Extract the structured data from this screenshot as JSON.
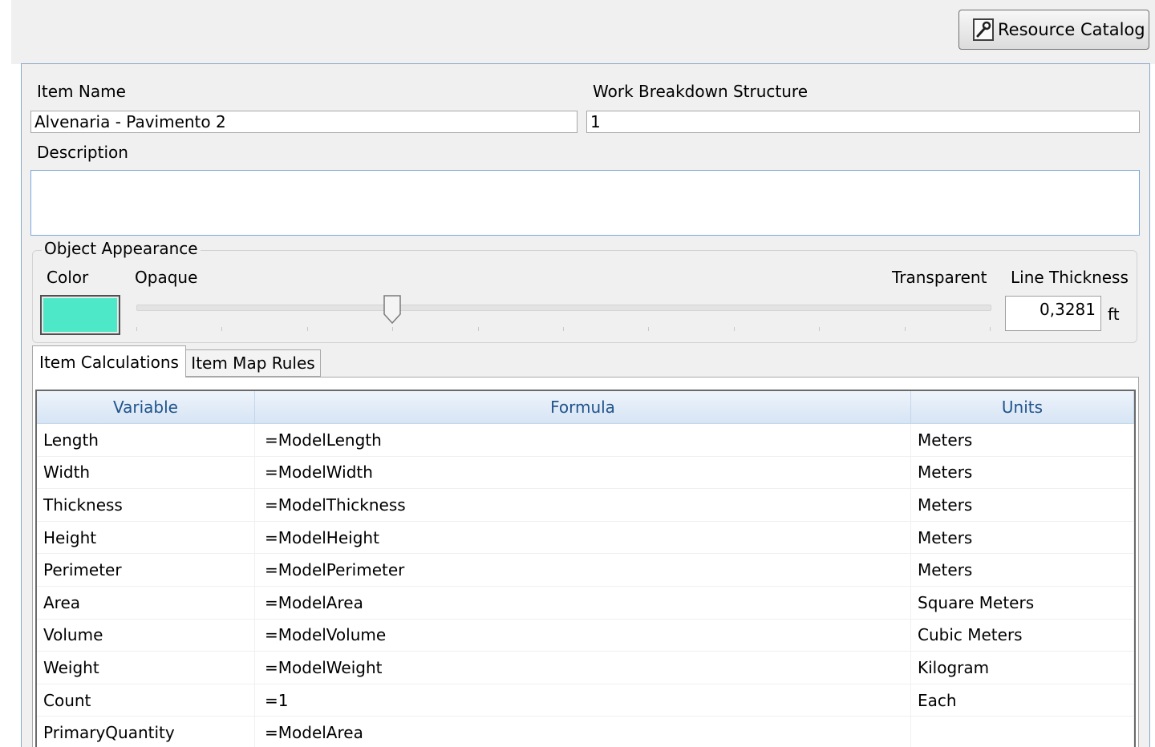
{
  "toolbar": {
    "resource_catalog_label": "Resource Catalog"
  },
  "form": {
    "item_name_label": "Item Name",
    "item_name_value": "Alvenaria - Pavimento 2",
    "wbs_label": "Work Breakdown Structure",
    "wbs_value": "1",
    "description_label": "Description",
    "description_value": ""
  },
  "appearance": {
    "group_label": "Object Appearance",
    "color_label": "Color",
    "color_hex": "#4de8c8",
    "opaque_label": "Opaque",
    "transparent_label": "Transparent",
    "transparency_fraction": 0.3,
    "line_thickness_label": "Line Thickness",
    "line_thickness_value": "0,3281",
    "line_thickness_unit": "ft"
  },
  "tabs": [
    {
      "label": "Item Calculations",
      "active": true
    },
    {
      "label": "Item Map Rules",
      "active": false
    }
  ],
  "table": {
    "headers": {
      "variable": "Variable",
      "formula": "Formula",
      "units": "Units"
    },
    "rows": [
      {
        "variable": "Length",
        "formula": "=ModelLength",
        "units": "Meters"
      },
      {
        "variable": "Width",
        "formula": "=ModelWidth",
        "units": "Meters"
      },
      {
        "variable": "Thickness",
        "formula": "=ModelThickness",
        "units": "Meters"
      },
      {
        "variable": "Height",
        "formula": "=ModelHeight",
        "units": "Meters"
      },
      {
        "variable": "Perimeter",
        "formula": "=ModelPerimeter",
        "units": "Meters"
      },
      {
        "variable": "Area",
        "formula": "=ModelArea",
        "units": "Square Meters"
      },
      {
        "variable": "Volume",
        "formula": "=ModelVolume",
        "units": "Cubic Meters"
      },
      {
        "variable": "Weight",
        "formula": "=ModelWeight",
        "units": "Kilogram"
      },
      {
        "variable": "Count",
        "formula": "=1",
        "units": "Each"
      },
      {
        "variable": "PrimaryQuantity",
        "formula": "=ModelArea",
        "units": ""
      }
    ]
  }
}
